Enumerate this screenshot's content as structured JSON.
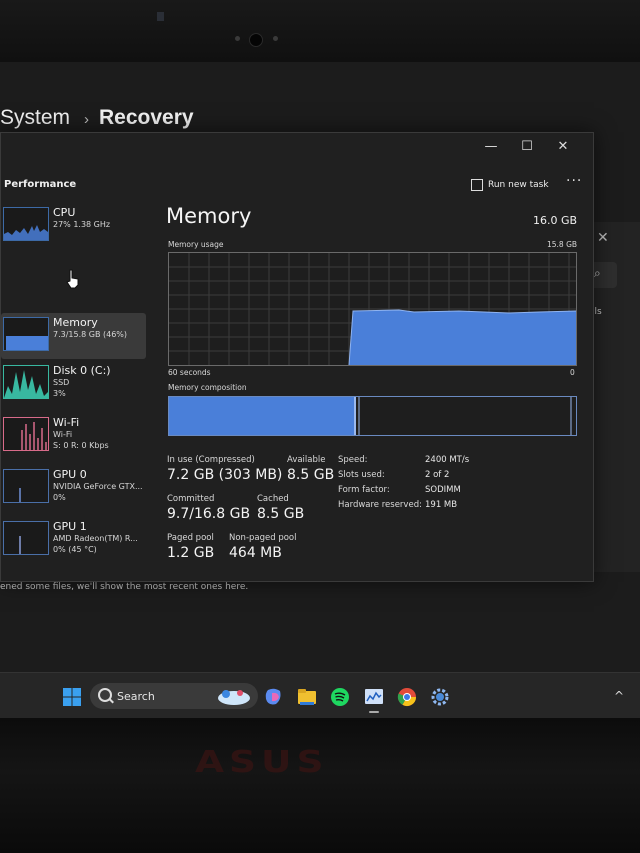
{
  "settings": {
    "breadcrumb_parent": "System",
    "breadcrumb_sep": "›",
    "breadcrumb_current": "Recovery",
    "recent_text": "ened some files, we'll show the most recent ones here.",
    "right_fragment": "ils"
  },
  "taskmanager": {
    "section_title": "Performance",
    "run_new_task": "Run new task",
    "more": "···",
    "caption": {
      "minimize": "—",
      "maximize": "☐",
      "close": "✕"
    },
    "sidebar": [
      {
        "name": "CPU",
        "sub1": "27% 1.38 GHz",
        "sub2": ""
      },
      {
        "name": "Memory",
        "sub1": "7.3/15.8 GB (46%)",
        "sub2": ""
      },
      {
        "name": "Disk 0 (C:)",
        "sub1": "SSD",
        "sub2": "3%"
      },
      {
        "name": "Wi-Fi",
        "sub1": "Wi-Fi",
        "sub2": "S: 0 R: 0 Kbps"
      },
      {
        "name": "GPU 0",
        "sub1": "NVIDIA GeForce GTX...",
        "sub2": "0%"
      },
      {
        "name": "GPU 1",
        "sub1": "AMD Radeon(TM) R...",
        "sub2": "0% (45 °C)"
      }
    ],
    "main": {
      "title": "Memory",
      "total": "16.0 GB",
      "usage_label": "Memory usage",
      "usage_max": "15.8 GB",
      "time_left": "60 seconds",
      "time_right": "0",
      "composition_label": "Memory composition",
      "in_use_label": "In use (Compressed)",
      "in_use_value": "7.2 GB (303 MB)",
      "available_label": "Available",
      "available_value": "8.5 GB",
      "committed_label": "Committed",
      "committed_value": "9.7/16.8 GB",
      "cached_label": "Cached",
      "cached_value": "8.5 GB",
      "paged_label": "Paged pool",
      "paged_value": "1.2 GB",
      "nonpaged_label": "Non-paged pool",
      "nonpaged_value": "464 MB",
      "specs": [
        {
          "key": "Speed:",
          "value": "2400 MT/s"
        },
        {
          "key": "Slots used:",
          "value": "2 of 2"
        },
        {
          "key": "Form factor:",
          "value": "SODIMM"
        },
        {
          "key": "Hardware reserved:",
          "value": "191 MB"
        }
      ]
    }
  },
  "taskbar": {
    "search_label": "Search"
  },
  "laptop": {
    "brand": "ASUS"
  },
  "colors": {
    "accent_blue": "#4a7fd9",
    "disk_green": "#38b8a0",
    "wifi_pink": "#d86b8a"
  }
}
